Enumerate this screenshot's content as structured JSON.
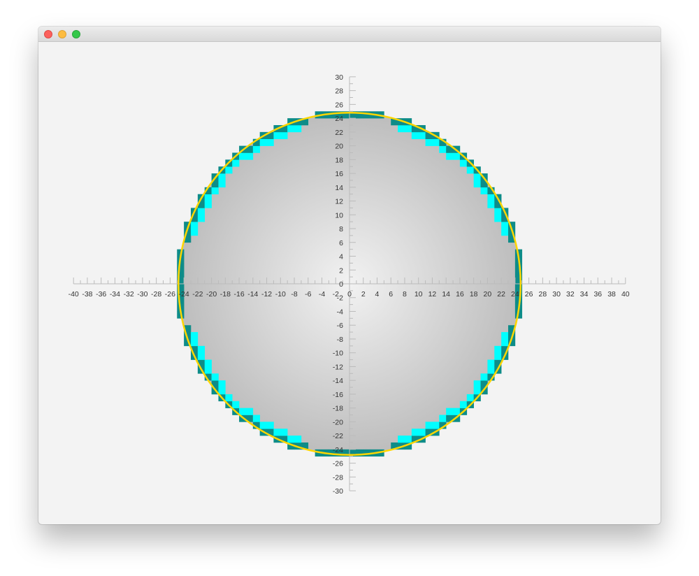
{
  "window": {
    "title": "",
    "buttons": [
      "close",
      "minimize",
      "zoom"
    ]
  },
  "chart_data": {
    "type": "circle rasterization plot",
    "xlim": [
      -40,
      40
    ],
    "ylim": [
      -30,
      30
    ],
    "x_tick_labels": [
      "-40",
      "-38",
      "-36",
      "-34",
      "-32",
      "-30",
      "-28",
      "-26",
      "-24",
      "-22",
      "-20",
      "-18",
      "-16",
      "-14",
      "-12",
      "-10",
      "-8",
      "-6",
      "-4",
      "-2",
      "0",
      "2",
      "4",
      "6",
      "8",
      "10",
      "12",
      "14",
      "16",
      "18",
      "20",
      "22",
      "24",
      "26",
      "28",
      "30",
      "32",
      "34",
      "36",
      "38",
      "40"
    ],
    "y_tick_labels": [
      "30",
      "28",
      "26",
      "24",
      "22",
      "20",
      "18",
      "16",
      "14",
      "12",
      "10",
      "8",
      "6",
      "4",
      "2",
      "0",
      "-2",
      "-4",
      "-6",
      "-8",
      "-10",
      "-12",
      "-14",
      "-16",
      "-18",
      "-20",
      "-22",
      "-24",
      "-26",
      "-28",
      "-30"
    ],
    "circle": {
      "center": [
        0,
        0
      ],
      "radius": 24.8
    },
    "grid": false,
    "colors": {
      "circle_fill_center": "#f2f2f2",
      "circle_fill_edge": "#bdbdbd",
      "outline": "#ffd600",
      "pixel_outer": "#0e8c88",
      "pixel_inner": "#00ffff",
      "axis": "#bbbbbb",
      "label": "#333333"
    }
  }
}
